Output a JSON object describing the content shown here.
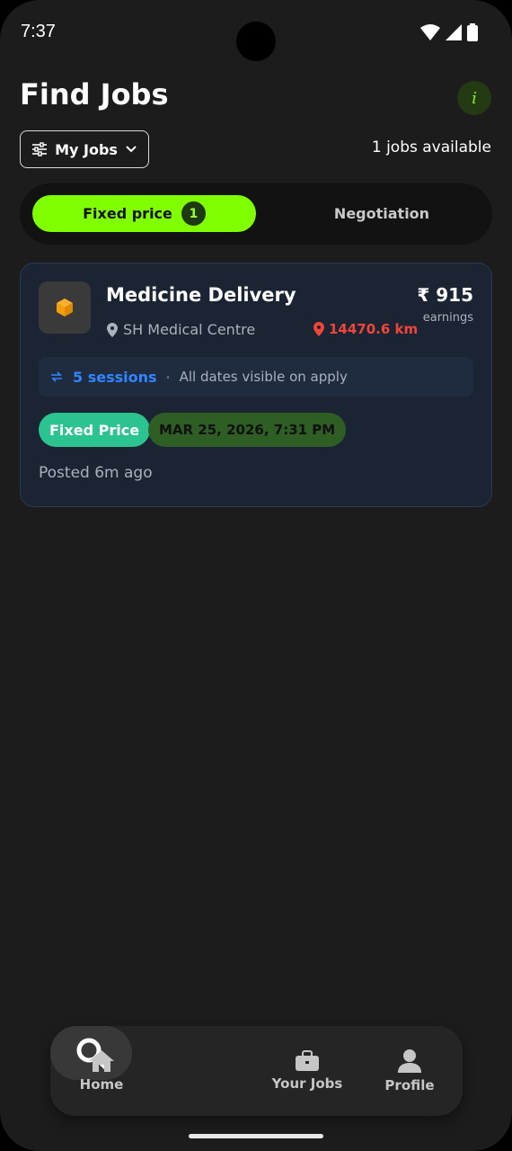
{
  "status_bar": {
    "time": "7:37"
  },
  "header": {
    "title": "Find Jobs",
    "info_icon": "info-icon"
  },
  "filter": {
    "my_jobs_label": "My Jobs",
    "jobs_available": "1 jobs available"
  },
  "tabs": {
    "fixed_label": "Fixed price",
    "fixed_count": "1",
    "negotiation_label": "Negotiation"
  },
  "job": {
    "title": "Medicine Delivery",
    "price": "₹ 915",
    "price_label": "earnings",
    "location": "SH Medical Centre",
    "distance": "14470.6 km",
    "sessions": "5 sessions",
    "separator": "·",
    "sessions_note": "All dates visible on apply",
    "type_badge": "Fixed Price",
    "date_badge": "MAR 25, 2026, 7:31 PM",
    "posted": "Posted 6m ago"
  },
  "nav": {
    "home": "Home",
    "your_jobs": "Your Jobs",
    "profile": "Profile"
  },
  "colors": {
    "accent": "#7fff00",
    "card_bg": "#1b2433",
    "session_blue": "#2f86ff",
    "distance_red": "#f0453a",
    "badge_green": "#2bc38f"
  }
}
